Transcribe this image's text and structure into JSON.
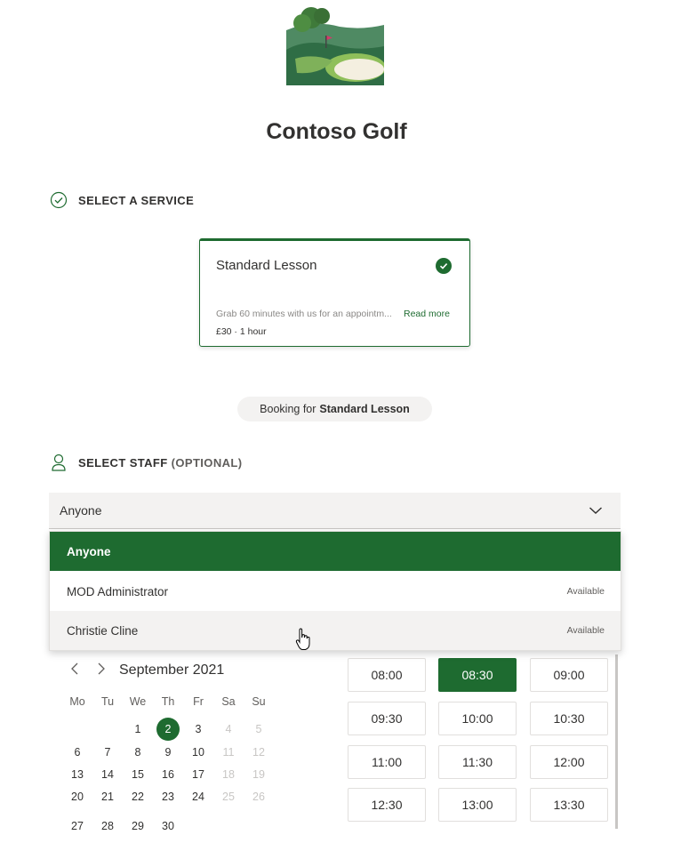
{
  "business": {
    "name": "Contoso Golf",
    "logo_icon": "golf-course-logo"
  },
  "service_section": {
    "heading": "SELECT A SERVICE",
    "icon": "check-circle-icon"
  },
  "service": {
    "name": "Standard Lesson",
    "description": "Grab 60 minutes with us for an appointm...",
    "read_more": "Read more",
    "price": "£30 · 1 hour",
    "selected": true
  },
  "booking_pill": {
    "prefix": "Booking for",
    "service": "Standard Lesson"
  },
  "staff_section": {
    "heading": "SELECT STAFF",
    "optional": "(OPTIONAL)",
    "icon": "person-icon"
  },
  "staff_select": {
    "value": "Anyone"
  },
  "staff_options": [
    {
      "name": "Anyone",
      "status": ""
    },
    {
      "name": "MOD Administrator",
      "status": "Available"
    },
    {
      "name": "Christie Cline",
      "status": "Available"
    }
  ],
  "calendar": {
    "month": "September 2021",
    "weekdays": [
      "Mo",
      "Tu",
      "We",
      "Th",
      "Fr",
      "Sa",
      "Su"
    ],
    "weeks": [
      [
        "",
        "",
        "1",
        "2",
        "3",
        "4",
        "5"
      ],
      [
        "6",
        "7",
        "8",
        "9",
        "10",
        "11",
        "12"
      ],
      [
        "13",
        "14",
        "15",
        "16",
        "17",
        "18",
        "19"
      ],
      [
        "20",
        "21",
        "22",
        "23",
        "24",
        "25",
        "26"
      ],
      [
        "27",
        "28",
        "29",
        "30",
        "",
        "",
        ""
      ]
    ],
    "selected_day": "2"
  },
  "time_slots": [
    "08:00",
    "08:30",
    "09:00",
    "09:30",
    "10:00",
    "10:30",
    "11:00",
    "11:30",
    "12:00",
    "12:30",
    "13:00",
    "13:30"
  ],
  "selected_slot": "08:30",
  "colors": {
    "brand": "#1e6b30",
    "field_bg": "#f3f2f1",
    "text": "#323130"
  }
}
